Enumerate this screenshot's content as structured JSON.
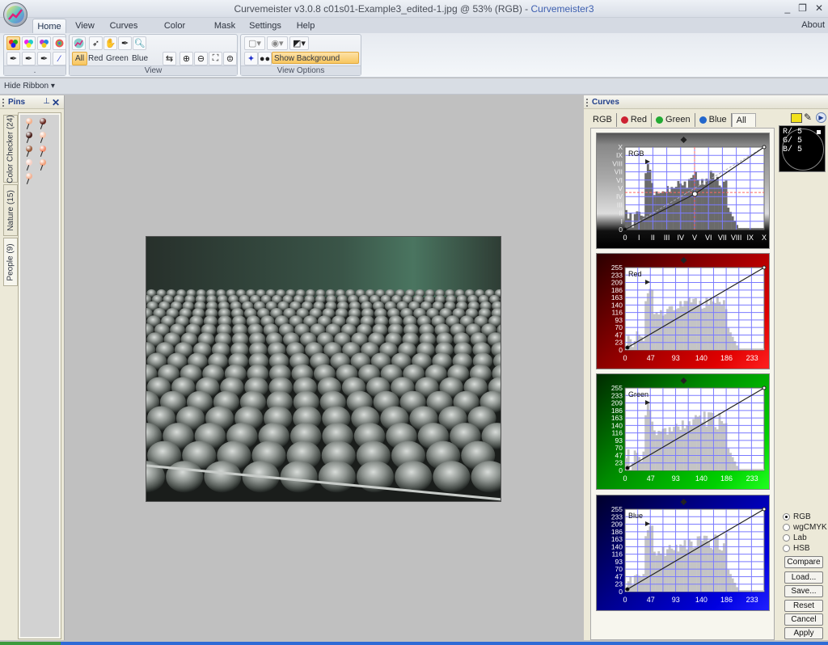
{
  "window": {
    "title_prefix": "Curvemeister v3.0.8     c01s01-Example3_edited-1.jpg @ 53% (RGB) - ",
    "app_name": "Curvemeister3",
    "minimize": "_",
    "maximize": "❐",
    "close": "✕"
  },
  "menu": {
    "tabs": [
      "Home",
      "View",
      "Curves",
      "Color Sample",
      "Mask",
      "Settings",
      "Help"
    ],
    "active": "Home",
    "about": "About"
  },
  "ribbon": {
    "group1_label": ".",
    "group2_label": "View",
    "group3_label": "View Options",
    "channels": [
      "All",
      "Red",
      "Green",
      "Blue"
    ],
    "active_channel": "All",
    "show_background_layers": "Show Background Layers",
    "hide_ribbon": "Hide Ribbon",
    "hide_ribbon_arrow": "▾"
  },
  "pins_panel": {
    "title": "Pins",
    "pin_icon": "ꟷ",
    "close": "✕",
    "tabs": [
      "Color Checker (24)",
      "Nature (15)",
      "People (9)"
    ],
    "active_tab": "People (9)",
    "pin_colors": [
      "#f2b08c",
      "#6a2a22",
      "#4a1f1a",
      "#f5c2a8",
      "#9a5a3a",
      "#f08a6a",
      "#f6d0c4",
      "#f2a07a",
      "#f2b294"
    ]
  },
  "image": {
    "filename": "c01s01-Example3_edited-1.jpg",
    "zoom": "53%",
    "mode": "RGB"
  },
  "curves_panel": {
    "title": "Curves",
    "tabs": [
      "RGB",
      "Red",
      "Green",
      "Blue",
      "All"
    ],
    "active_tab": "All",
    "tab_dot_colors": [
      "",
      "#cc2233",
      "#22aa33",
      "#2266cc",
      ""
    ],
    "rgb_graph": {
      "label": "RGB",
      "y_ticks": [
        "X",
        "IX",
        "VIII",
        "VII",
        "VI",
        "V",
        "IV",
        "III",
        "II",
        "I",
        "0"
      ],
      "x_ticks": [
        "0",
        "I",
        "II",
        "III",
        "IV",
        "V",
        "VI",
        "VII",
        "VIII",
        "IX",
        "X"
      ],
      "curve_points": [
        [
          0,
          0
        ],
        [
          128,
          110
        ],
        [
          255,
          255
        ]
      ]
    },
    "channel_graphs": [
      {
        "label": "Red",
        "color": "#cc0000",
        "y_ticks": [
          "255",
          "233",
          "209",
          "186",
          "163",
          "140",
          "116",
          "93",
          "70",
          "47",
          "23",
          "0"
        ],
        "x_ticks": [
          "0",
          "47",
          "93",
          "140",
          "186",
          "233"
        ]
      },
      {
        "label": "Green",
        "color": "#00aa00",
        "y_ticks": [
          "255",
          "233",
          "209",
          "186",
          "163",
          "140",
          "116",
          "93",
          "70",
          "47",
          "23",
          "0"
        ],
        "x_ticks": [
          "0",
          "47",
          "93",
          "140",
          "186",
          "233"
        ]
      },
      {
        "label": "Blue",
        "color": "#0000cc",
        "y_ticks": [
          "255",
          "233",
          "209",
          "186",
          "163",
          "140",
          "116",
          "93",
          "70",
          "47",
          "23",
          "0"
        ],
        "x_ticks": [
          "0",
          "47",
          "93",
          "140",
          "186",
          "233"
        ]
      }
    ],
    "readout": {
      "r": "R/    5",
      "g": "G/    5",
      "b": "B/    5"
    },
    "color_modes": [
      "RGB",
      "wgCMYK",
      "Lab",
      "HSB"
    ],
    "selected_mode": "RGB",
    "buttons": [
      "Compare",
      "Load...",
      "Save...",
      "Reset",
      "Cancel",
      "Apply"
    ]
  }
}
